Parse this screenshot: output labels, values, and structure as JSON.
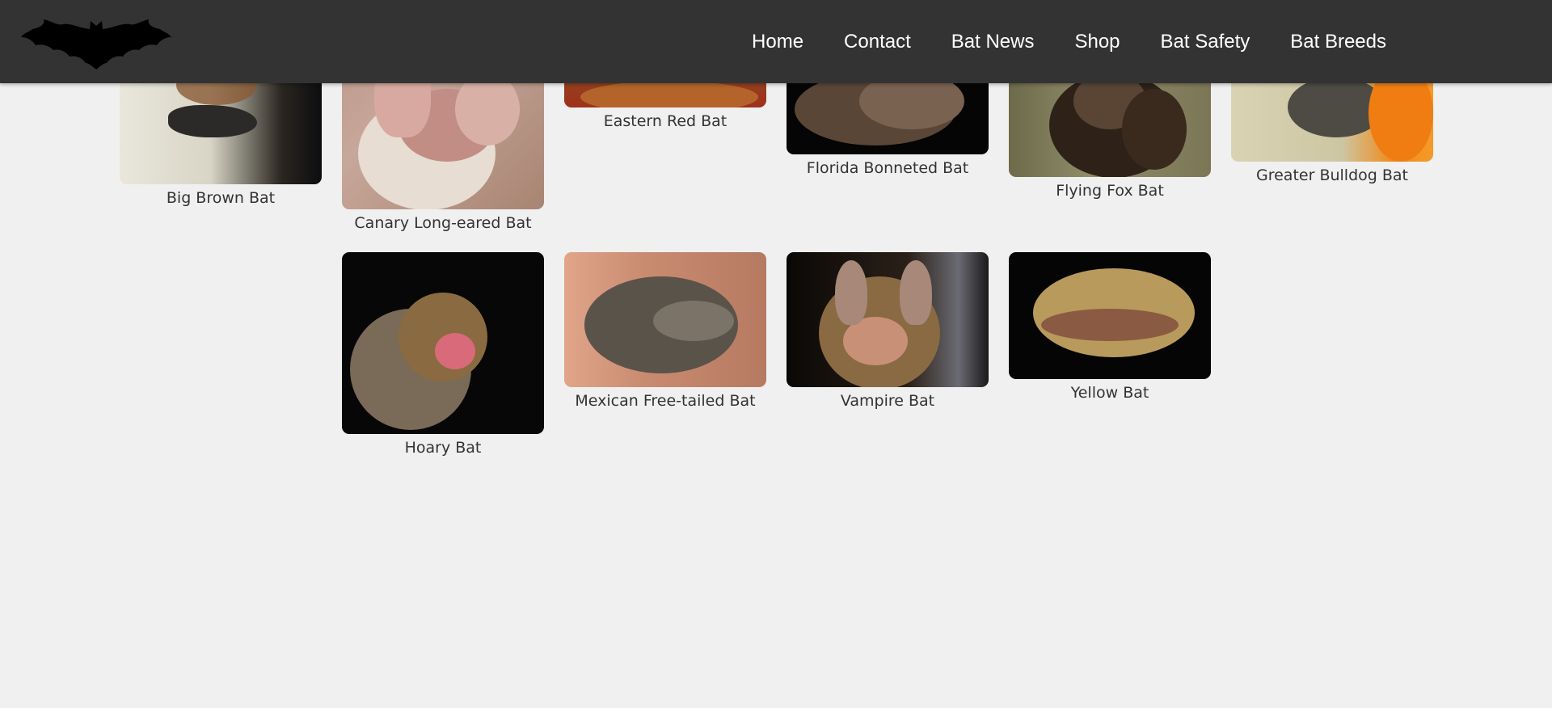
{
  "nav": {
    "logo": "bat-logo",
    "links": [
      "Home",
      "Contact",
      "Bat News",
      "Shop",
      "Bat Safety",
      "Bat Breeds"
    ]
  },
  "gallery": {
    "row1": [
      {
        "name": "Big Brown Bat"
      },
      {
        "name": "Canary Long-eared Bat"
      },
      {
        "name": "Eastern Red Bat"
      },
      {
        "name": "Florida Bonneted Bat"
      },
      {
        "name": "Flying Fox Bat"
      },
      {
        "name": "Greater Bulldog Bat"
      }
    ],
    "row2": [
      {
        "name": "Hoary Bat"
      },
      {
        "name": "Mexican Free-tailed Bat"
      },
      {
        "name": "Vampire Bat"
      },
      {
        "name": "Yellow Bat"
      }
    ]
  }
}
